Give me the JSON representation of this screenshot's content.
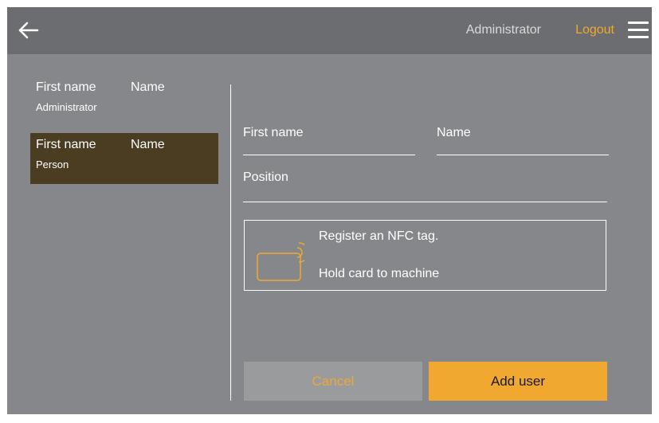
{
  "header": {
    "back_icon": "arrow-left-icon",
    "user": "Administrator",
    "logout": "Logout",
    "menu_icon": "hamburger-menu-icon"
  },
  "users": [
    {
      "first_name": "First name",
      "last_name": "Name",
      "role": "Administrator",
      "selected": false
    },
    {
      "first_name": "First name",
      "last_name": "Name",
      "role": "Person",
      "selected": true
    }
  ],
  "form": {
    "first_name_placeholder": "First name",
    "name_placeholder": "Name",
    "position_placeholder": "Position",
    "nfc_line1": "Register an NFC tag.",
    "nfc_line2": "Hold card to machine",
    "nfc_icon": "nfc-card-icon",
    "cancel_label": "Cancel",
    "add_label": "Add user"
  },
  "colors": {
    "background": "#85878a",
    "topbar": "#6b6d70",
    "accent": "#f0a830",
    "selected_row": "#4b3d22",
    "cancel_bg": "#9a9b9d"
  }
}
